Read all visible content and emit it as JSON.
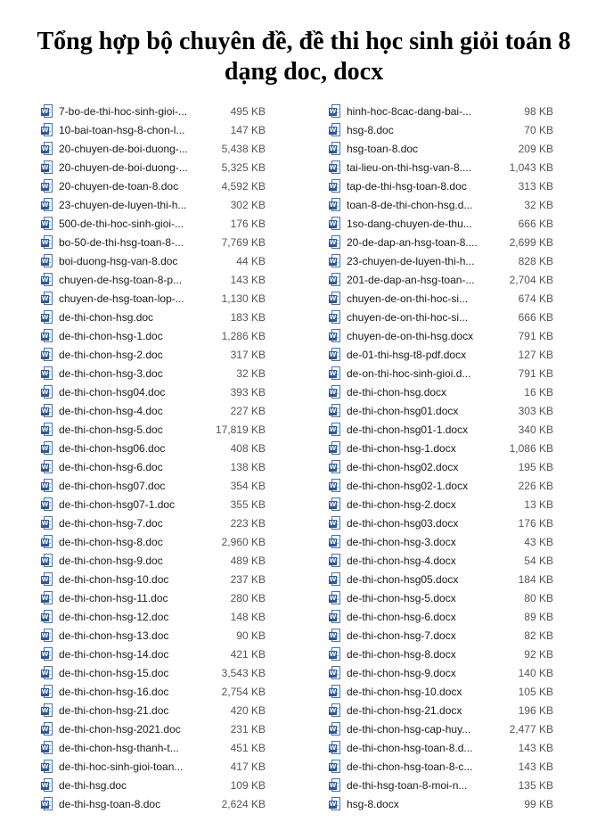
{
  "title": "Tổng hợp bộ chuyên đề, đề thi học sinh giỏi toán 8 dạng doc, docx",
  "icon": "word-document-icon",
  "left_files": [
    {
      "name": "7-bo-de-thi-hoc-sinh-gioi-...",
      "size": "495 KB"
    },
    {
      "name": "10-bai-toan-hsg-8-chon-l...",
      "size": "147 KB"
    },
    {
      "name": "20-chuyen-de-boi-duong-...",
      "size": "5,438 KB"
    },
    {
      "name": "20-chuyen-de-boi-duong-...",
      "size": "5,325 KB"
    },
    {
      "name": "20-chuyen-de-toan-8.doc",
      "size": "4,592 KB"
    },
    {
      "name": "23-chuyen-de-luyen-thi-h...",
      "size": "302 KB"
    },
    {
      "name": "500-de-thi-hoc-sinh-gioi-...",
      "size": "176 KB"
    },
    {
      "name": "bo-50-de-thi-hsg-toan-8-...",
      "size": "7,769 KB"
    },
    {
      "name": "boi-duong-hsg-van-8.doc",
      "size": "44 KB"
    },
    {
      "name": "chuyen-de-hsg-toan-8-p...",
      "size": "143 KB"
    },
    {
      "name": "chuyen-de-hsg-toan-lop-...",
      "size": "1,130 KB"
    },
    {
      "name": "de-thi-chon-hsg.doc",
      "size": "183 KB"
    },
    {
      "name": "de-thi-chon-hsg-1.doc",
      "size": "1,286 KB"
    },
    {
      "name": "de-thi-chon-hsg-2.doc",
      "size": "317 KB"
    },
    {
      "name": "de-thi-chon-hsg-3.doc",
      "size": "32 KB"
    },
    {
      "name": "de-thi-chon-hsg04.doc",
      "size": "393 KB"
    },
    {
      "name": "de-thi-chon-hsg-4.doc",
      "size": "227 KB"
    },
    {
      "name": "de-thi-chon-hsg-5.doc",
      "size": "17,819 KB"
    },
    {
      "name": "de-thi-chon-hsg06.doc",
      "size": "408 KB"
    },
    {
      "name": "de-thi-chon-hsg-6.doc",
      "size": "138 KB"
    },
    {
      "name": "de-thi-chon-hsg07.doc",
      "size": "354 KB"
    },
    {
      "name": "de-thi-chon-hsg07-1.doc",
      "size": "355 KB"
    },
    {
      "name": "de-thi-chon-hsg-7.doc",
      "size": "223 KB"
    },
    {
      "name": "de-thi-chon-hsg-8.doc",
      "size": "2,960 KB"
    },
    {
      "name": "de-thi-chon-hsg-9.doc",
      "size": "489 KB"
    },
    {
      "name": "de-thi-chon-hsg-10.doc",
      "size": "237 KB"
    },
    {
      "name": "de-thi-chon-hsg-11.doc",
      "size": "280 KB"
    },
    {
      "name": "de-thi-chon-hsg-12.doc",
      "size": "148 KB"
    },
    {
      "name": "de-thi-chon-hsg-13.doc",
      "size": "90 KB"
    },
    {
      "name": "de-thi-chon-hsg-14.doc",
      "size": "421 KB"
    },
    {
      "name": "de-thi-chon-hsg-15.doc",
      "size": "3,543 KB"
    },
    {
      "name": "de-thi-chon-hsg-16.doc",
      "size": "2,754 KB"
    },
    {
      "name": "de-thi-chon-hsg-21.doc",
      "size": "420 KB"
    },
    {
      "name": "de-thi-chon-hsg-2021.doc",
      "size": "231 KB"
    },
    {
      "name": "de-thi-chon-hsg-thanh-t...",
      "size": "451 KB"
    },
    {
      "name": "de-thi-hoc-sinh-gioi-toan...",
      "size": "417 KB"
    },
    {
      "name": "de-thi-hsg.doc",
      "size": "109 KB"
    },
    {
      "name": "de-thi-hsg-toan-8.doc",
      "size": "2,624 KB"
    }
  ],
  "right_files": [
    {
      "name": "hinh-hoc-8cac-dang-bai-...",
      "size": "98 KB"
    },
    {
      "name": "hsg-8.doc",
      "size": "70 KB"
    },
    {
      "name": "hsg-toan-8.doc",
      "size": "209 KB"
    },
    {
      "name": "tai-lieu-on-thi-hsg-van-8....",
      "size": "1,043 KB"
    },
    {
      "name": "tap-de-thi-hsg-toan-8.doc",
      "size": "313 KB"
    },
    {
      "name": "toan-8-de-thi-chon-hsg.d...",
      "size": "32 KB"
    },
    {
      "name": "1so-dang-chuyen-de-thu...",
      "size": "666 KB"
    },
    {
      "name": "20-de-dap-an-hsg-toan-8....",
      "size": "2,699 KB"
    },
    {
      "name": "23-chuyen-de-luyen-thi-h...",
      "size": "828 KB"
    },
    {
      "name": "201-de-dap-an-hsg-toan-...",
      "size": "2,704 KB"
    },
    {
      "name": "chuyen-de-on-thi-hoc-si...",
      "size": "674 KB"
    },
    {
      "name": "chuyen-de-on-thi-hoc-si...",
      "size": "666 KB"
    },
    {
      "name": "chuyen-de-on-thi-hsg.docx",
      "size": "791 KB"
    },
    {
      "name": "de-01-thi-hsg-t8-pdf.docx",
      "size": "127 KB"
    },
    {
      "name": "de-on-thi-hoc-sinh-gioi.d...",
      "size": "791 KB"
    },
    {
      "name": "de-thi-chon-hsg.docx",
      "size": "16 KB"
    },
    {
      "name": "de-thi-chon-hsg01.docx",
      "size": "303 KB"
    },
    {
      "name": "de-thi-chon-hsg01-1.docx",
      "size": "340 KB"
    },
    {
      "name": "de-thi-chon-hsg-1.docx",
      "size": "1,086 KB"
    },
    {
      "name": "de-thi-chon-hsg02.docx",
      "size": "195 KB"
    },
    {
      "name": "de-thi-chon-hsg02-1.docx",
      "size": "226 KB"
    },
    {
      "name": "de-thi-chon-hsg-2.docx",
      "size": "13 KB"
    },
    {
      "name": "de-thi-chon-hsg03.docx",
      "size": "176 KB"
    },
    {
      "name": "de-thi-chon-hsg-3.docx",
      "size": "43 KB"
    },
    {
      "name": "de-thi-chon-hsg-4.docx",
      "size": "54 KB"
    },
    {
      "name": "de-thi-chon-hsg05.docx",
      "size": "184 KB"
    },
    {
      "name": "de-thi-chon-hsg-5.docx",
      "size": "80 KB"
    },
    {
      "name": "de-thi-chon-hsg-6.docx",
      "size": "89 KB"
    },
    {
      "name": "de-thi-chon-hsg-7.docx",
      "size": "82 KB"
    },
    {
      "name": "de-thi-chon-hsg-8.docx",
      "size": "92 KB"
    },
    {
      "name": "de-thi-chon-hsg-9.docx",
      "size": "140 KB"
    },
    {
      "name": "de-thi-chon-hsg-10.docx",
      "size": "105 KB"
    },
    {
      "name": "de-thi-chon-hsg-21.docx",
      "size": "196 KB"
    },
    {
      "name": "de-thi-chon-hsg-cap-huy...",
      "size": "2,477 KB"
    },
    {
      "name": "de-thi-chon-hsg-toan-8.d...",
      "size": "143 KB"
    },
    {
      "name": "de-thi-chon-hsg-toan-8-c...",
      "size": "143 KB"
    },
    {
      "name": "de-thi-hsg-toan-8-moi-n...",
      "size": "135 KB"
    },
    {
      "name": "hsg-8.docx",
      "size": "99 KB"
    }
  ]
}
